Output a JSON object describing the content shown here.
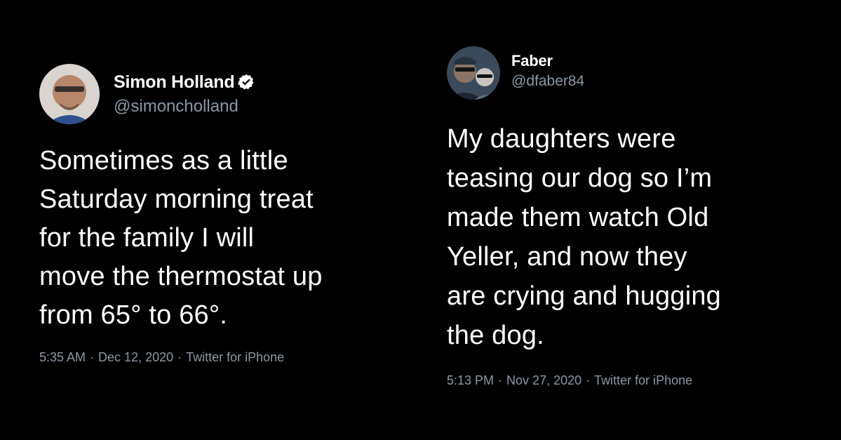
{
  "tweets": [
    {
      "display_name": "Simon Holland",
      "verified": true,
      "verified_icon": "verified-badge-icon",
      "handle": "@simoncholland",
      "text": "Sometimes as a little\nSaturday morning treat\nfor the family I will\nmove the thermostat up\nfrom 65° to 66°.",
      "time": "5:35 AM",
      "separator_1": "·",
      "date": "Dec 12, 2020",
      "separator_2": "·",
      "source": "Twitter for iPhone"
    },
    {
      "display_name": "Faber",
      "verified": false,
      "handle": "@dfaber84",
      "text": "My daughters were\nteasing our dog so I’m\nmade them watch Old\nYeller, and now they\nare crying and hugging\nthe dog.",
      "time": "5:13 PM",
      "separator_1": "·",
      "date": "Nov 27, 2020",
      "separator_2": "·",
      "source": "Twitter for iPhone"
    }
  ],
  "colors": {
    "background": "#000000",
    "text": "#ffffff",
    "secondary_text": "#8b98a5",
    "verified_badge": "#ffffff"
  }
}
